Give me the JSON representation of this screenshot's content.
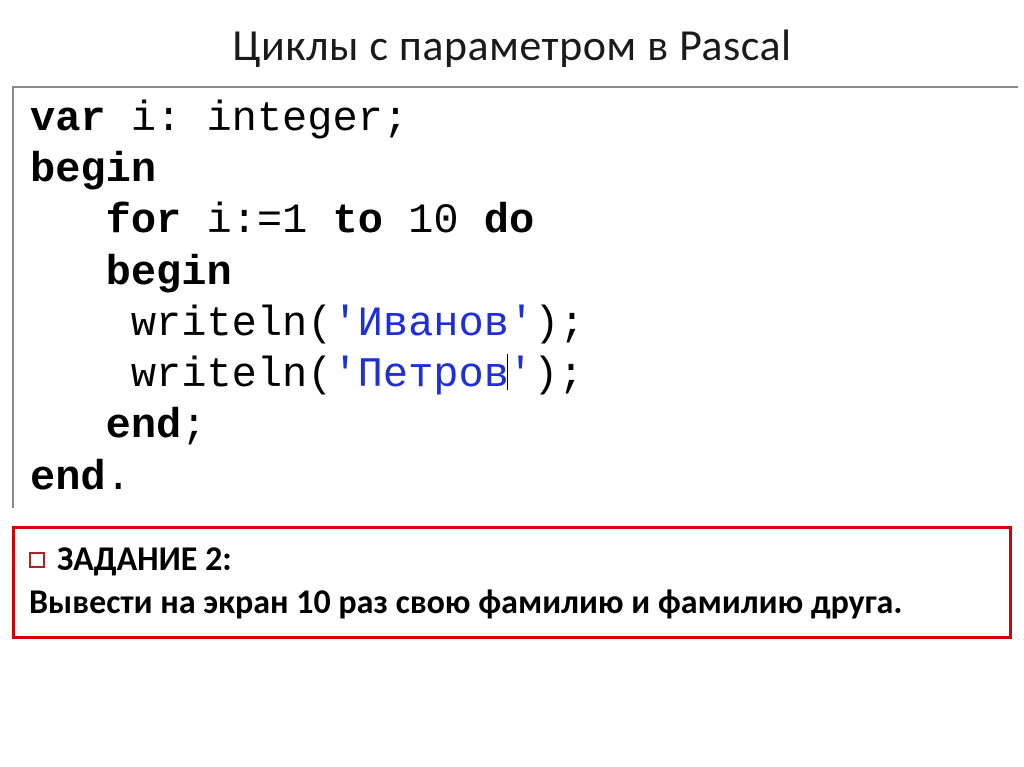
{
  "title": "Циклы с параметром в Pascal",
  "code": {
    "l1_kw1": "var",
    "l1_rest": " i: integer;",
    "l2_kw": "begin",
    "l3_indent": "   ",
    "l3_kw1": "for",
    "l3_mid": " i:=1 ",
    "l3_kw2": "to",
    "l3_mid2": " 10 ",
    "l3_kw3": "do",
    "l4_indent": "   ",
    "l4_kw": "begin",
    "l5_indent": "    ",
    "l5_call": "writeln(",
    "l5_str": "'Иванов'",
    "l5_end": ");",
    "l6_indent": "    ",
    "l6_call": "writeln(",
    "l6_str_a": "'Петров",
    "l6_str_b": "'",
    "l6_end": ");",
    "l7_indent": "   ",
    "l7_kw": "end",
    "l7_semi": ";",
    "l8_kw": "end",
    "l8_dot": "."
  },
  "task": {
    "heading": "ЗАДАНИЕ 2:",
    "body": "Вывести на экран 10 раз свою фамилию и фамилию друга."
  }
}
